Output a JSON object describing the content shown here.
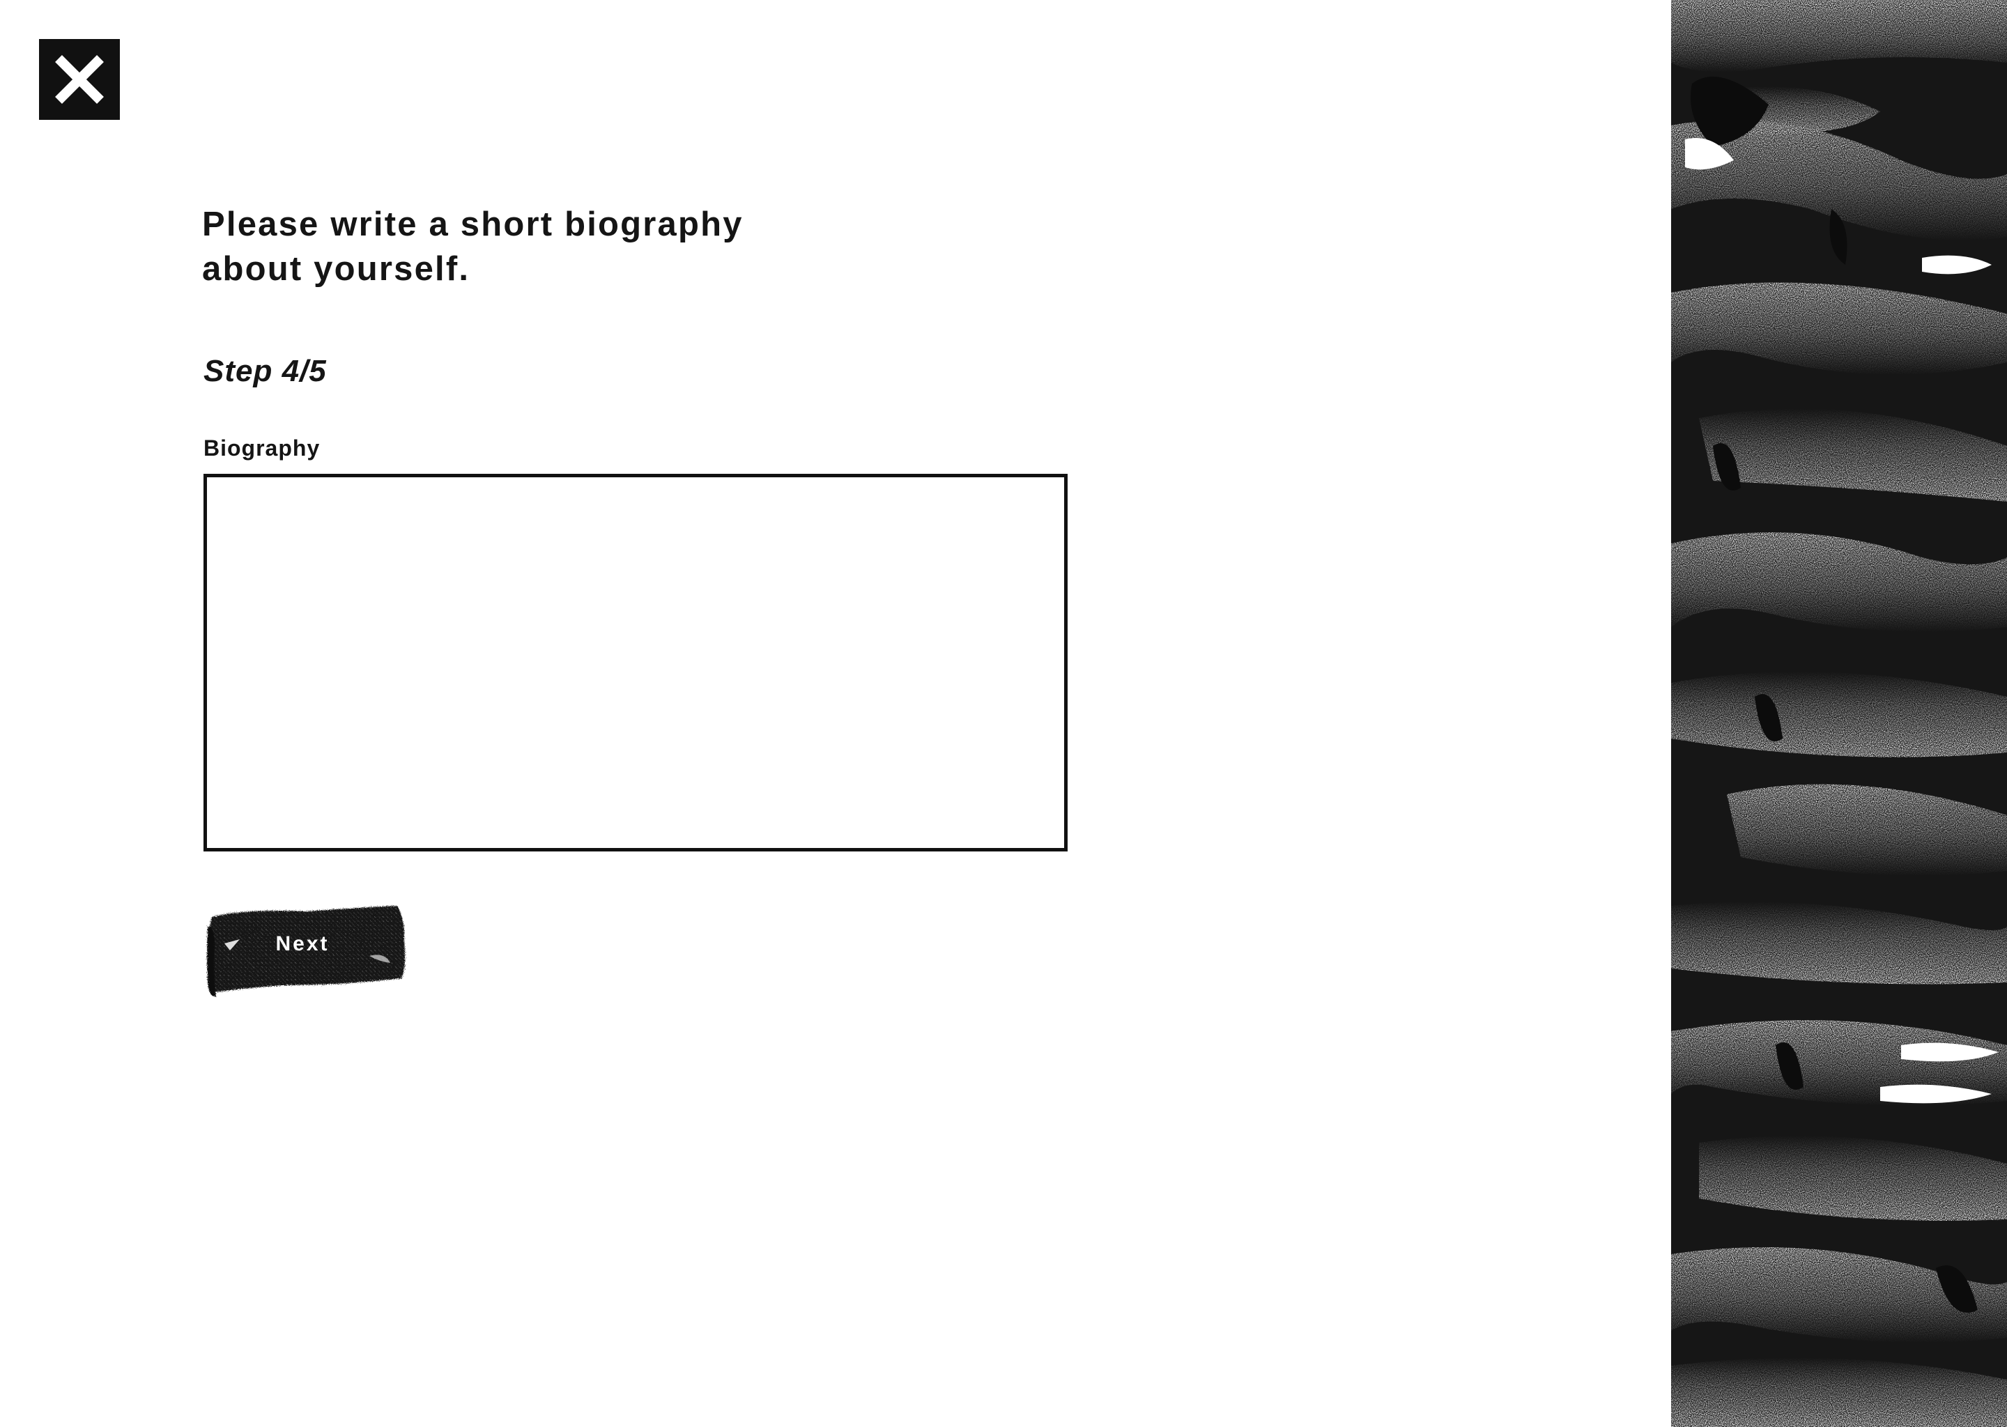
{
  "close": {
    "icon": "close-icon"
  },
  "form": {
    "title": "Please write a short biography about yourself.",
    "step": "Step 4/5",
    "field_label": "Biography",
    "field_value": "",
    "next_label": "Next"
  },
  "colors": {
    "background": "#ffffff",
    "ink": "#111111",
    "button_text": "#ffffff"
  },
  "decoration": {
    "icon": "stippled-ribbon-art"
  }
}
